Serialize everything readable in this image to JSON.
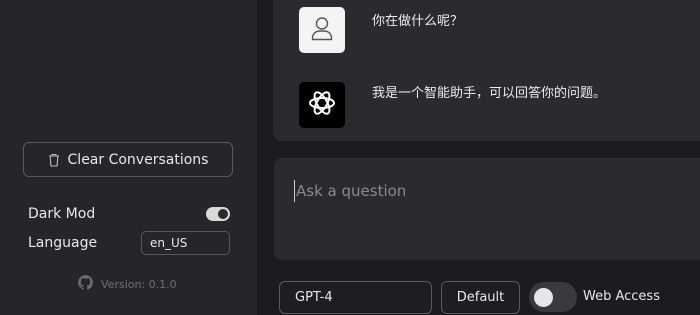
{
  "sidebar": {
    "clear_button_label": "Clear Conversations",
    "dark_mode_label": "Dark Mod",
    "dark_mode_enabled": true,
    "language_label": "Language",
    "language_value": "en_US",
    "version_text": "Version: 0.1.0"
  },
  "chat": {
    "messages": [
      {
        "role": "user",
        "icon": "user-icon",
        "text": "你在做什么呢？"
      },
      {
        "role": "assistant",
        "icon": "openai-logo-icon",
        "text": "我是一个智能助手，可以回答你的问题。"
      }
    ]
  },
  "composer": {
    "placeholder": "Ask a question",
    "value": ""
  },
  "footer": {
    "model": "GPT-4",
    "default_button_label": "Default",
    "web_access_label": "Web Access",
    "web_access_enabled": false
  },
  "colors": {
    "sidebar_bg": "#262628",
    "main_bg": "#1c1c1e",
    "panel_bg": "#2b2b2d",
    "border": "#5a5a5e"
  }
}
